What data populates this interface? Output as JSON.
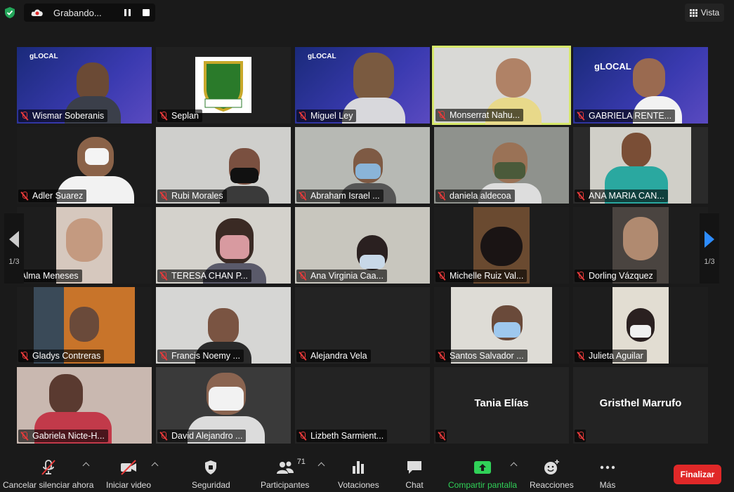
{
  "recording": {
    "label": "Grabando..."
  },
  "view_button": {
    "label": "Vista"
  },
  "pagination": {
    "left": "1/3",
    "right": "1/3"
  },
  "active_speaker_color": "#d7e86a",
  "participants": [
    {
      "name": "Wismar Soberanis"
    },
    {
      "name": "Seplan"
    },
    {
      "name": "Miguel Ley"
    },
    {
      "name": "Monserrat Nahu..."
    },
    {
      "name": "GABRIELA RENTE..."
    },
    {
      "name": "Adler Suarez"
    },
    {
      "name": "Rubi Morales"
    },
    {
      "name": "Abraham Israel ..."
    },
    {
      "name": "daniela aldecoa"
    },
    {
      "name": "ANA MARIA CAN..."
    },
    {
      "name": "Alma Meneses"
    },
    {
      "name": "TERESA CHAN P..."
    },
    {
      "name": "Ana Virginia Caa..."
    },
    {
      "name": "Michelle Ruiz Val..."
    },
    {
      "name": "Dorling Vázquez"
    },
    {
      "name": "Gladys Contreras"
    },
    {
      "name": "Francis Noemy ..."
    },
    {
      "name": "Alejandra Vela"
    },
    {
      "name": "Santos Salvador ..."
    },
    {
      "name": "Julieta Aguilar"
    },
    {
      "name": "Gabriela Nicte-H..."
    },
    {
      "name": "David Alejandro ..."
    },
    {
      "name": "Lizbeth Sarmient..."
    },
    {
      "name": "Tania Elías"
    },
    {
      "name": "Gristhel Marrufo"
    }
  ],
  "toolbar": {
    "mute": "Cancelar silenciar ahora",
    "video": "Iniciar video",
    "security": "Seguridad",
    "participants": "Participantes",
    "participants_count": "71",
    "polls": "Votaciones",
    "chat": "Chat",
    "share": "Compartir pantalla",
    "reactions": "Reacciones",
    "more": "Más",
    "end": "Finalizar"
  },
  "slide_text": {
    "brand": "gLOCAL"
  }
}
